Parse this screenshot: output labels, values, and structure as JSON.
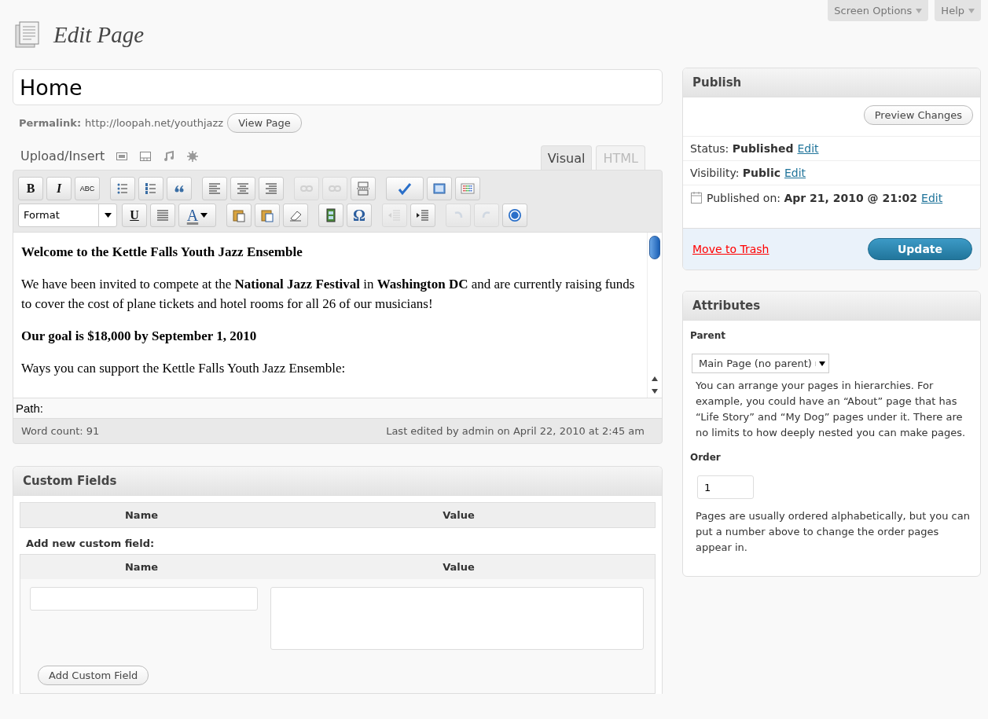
{
  "header": {
    "title": "Edit Page",
    "buttons": [
      {
        "label": "Screen Options"
      },
      {
        "label": "Help"
      }
    ]
  },
  "post_title": {
    "value": "Home"
  },
  "permalink": {
    "label": "Permalink:",
    "url": "http://loopah.net/youthjazz",
    "button": "View Page"
  },
  "media": {
    "label": "Upload/Insert",
    "icons": [
      {
        "kind": "image"
      },
      {
        "kind": "video"
      },
      {
        "kind": "audio"
      },
      {
        "kind": "media"
      }
    ]
  },
  "editor_tabs": [
    {
      "label": "Visual",
      "selected": true
    },
    {
      "label": "HTML",
      "selected": false
    }
  ],
  "toolbar": [
    [
      {
        "kind": "bold",
        "label": "B",
        "disabled": false
      },
      {
        "kind": "italic",
        "label": "I",
        "disabled": false
      },
      {
        "kind": "strike",
        "label": "ABC",
        "disabled": false
      },
      {
        "kind": "sep"
      },
      {
        "kind": "bullets",
        "disabled": false
      },
      {
        "kind": "numbers",
        "disabled": false
      },
      {
        "kind": "quote",
        "disabled": false
      },
      {
        "kind": "sep"
      },
      {
        "kind": "align-left",
        "disabled": false
      },
      {
        "kind": "align-center",
        "disabled": false
      },
      {
        "kind": "align-right",
        "disabled": false
      },
      {
        "kind": "sep"
      },
      {
        "kind": "link",
        "disabled": true
      },
      {
        "kind": "unlink",
        "disabled": true
      },
      {
        "kind": "more",
        "disabled": false
      },
      {
        "kind": "sep"
      },
      {
        "kind": "spell",
        "disabled": false
      },
      {
        "kind": "fullscreen",
        "disabled": false
      },
      {
        "kind": "kitchen",
        "disabled": false
      }
    ],
    [
      {
        "kind": "format",
        "label": "Format",
        "disabled": false
      },
      {
        "kind": "underline",
        "label": "U",
        "disabled": false
      },
      {
        "kind": "justify",
        "disabled": false
      },
      {
        "kind": "color",
        "label": "A",
        "disabled": false
      },
      {
        "kind": "sep"
      },
      {
        "kind": "paste-text",
        "disabled": false
      },
      {
        "kind": "paste-word",
        "disabled": false
      },
      {
        "kind": "eraser",
        "disabled": false
      },
      {
        "kind": "sep"
      },
      {
        "kind": "film",
        "disabled": false
      },
      {
        "kind": "char",
        "label": "Ω",
        "disabled": false
      },
      {
        "kind": "sep"
      },
      {
        "kind": "outdent",
        "disabled": true
      },
      {
        "kind": "indent",
        "disabled": false
      },
      {
        "kind": "sep"
      },
      {
        "kind": "undo",
        "disabled": true
      },
      {
        "kind": "redo",
        "disabled": true
      },
      {
        "kind": "help",
        "disabled": false
      }
    ]
  ],
  "content": [
    {
      "kind": "bold",
      "text": "Welcome to the Kettle Falls Youth Jazz Ensemble"
    },
    {
      "kind": "para",
      "text": "We have been invited to compete at the **National Jazz Festival** in **Washington DC** and are currently raising funds to cover the cost of plane tickets and hotel rooms for all 26 of our musicians!"
    },
    {
      "kind": "bold",
      "text": "Our goal is $18,000 by September 1, 2010"
    },
    {
      "kind": "para",
      "text": "Ways you can support the Kettle Falls Youth Jazz Ensemble:"
    }
  ],
  "path_label": "Path:",
  "word_count": "Word count: 91",
  "last_edited": "Last edited by admin on April 22, 2010 at 2:45 am",
  "custom_fields": {
    "title": "Custom Fields",
    "columns": [
      "Name",
      "Value"
    ],
    "add_label": "Add new custom field:",
    "add_columns": [
      "Name",
      "Value"
    ],
    "button": "Add Custom Field"
  },
  "publish": {
    "title": "Publish",
    "preview": "Preview Changes",
    "rows": [
      {
        "kind": "status",
        "label": "Status:",
        "value": "Published",
        "link": "Edit"
      },
      {
        "kind": "visibility",
        "label": "Visibility:",
        "value": "Public",
        "link": "Edit"
      },
      {
        "kind": "date",
        "label": "Published on:",
        "value": "Apr 21, 2010 @ 21:02",
        "link": "Edit"
      }
    ],
    "trash": "Move to Trash",
    "update": "Update"
  },
  "attributes": {
    "title": "Attributes",
    "parent_label": "Parent",
    "parent_value": "Main Page (no parent)",
    "parent_help": "You can arrange your pages in hierarchies. For example, you could have an “About” page that has “Life Story” and “My Dog” pages under it. There are no limits to how deeply nested you can make pages.",
    "order_label": "Order",
    "order_value": "1",
    "order_help": "Pages are usually ordered alphabetically, but you can put a number above to change the order pages appear in."
  }
}
